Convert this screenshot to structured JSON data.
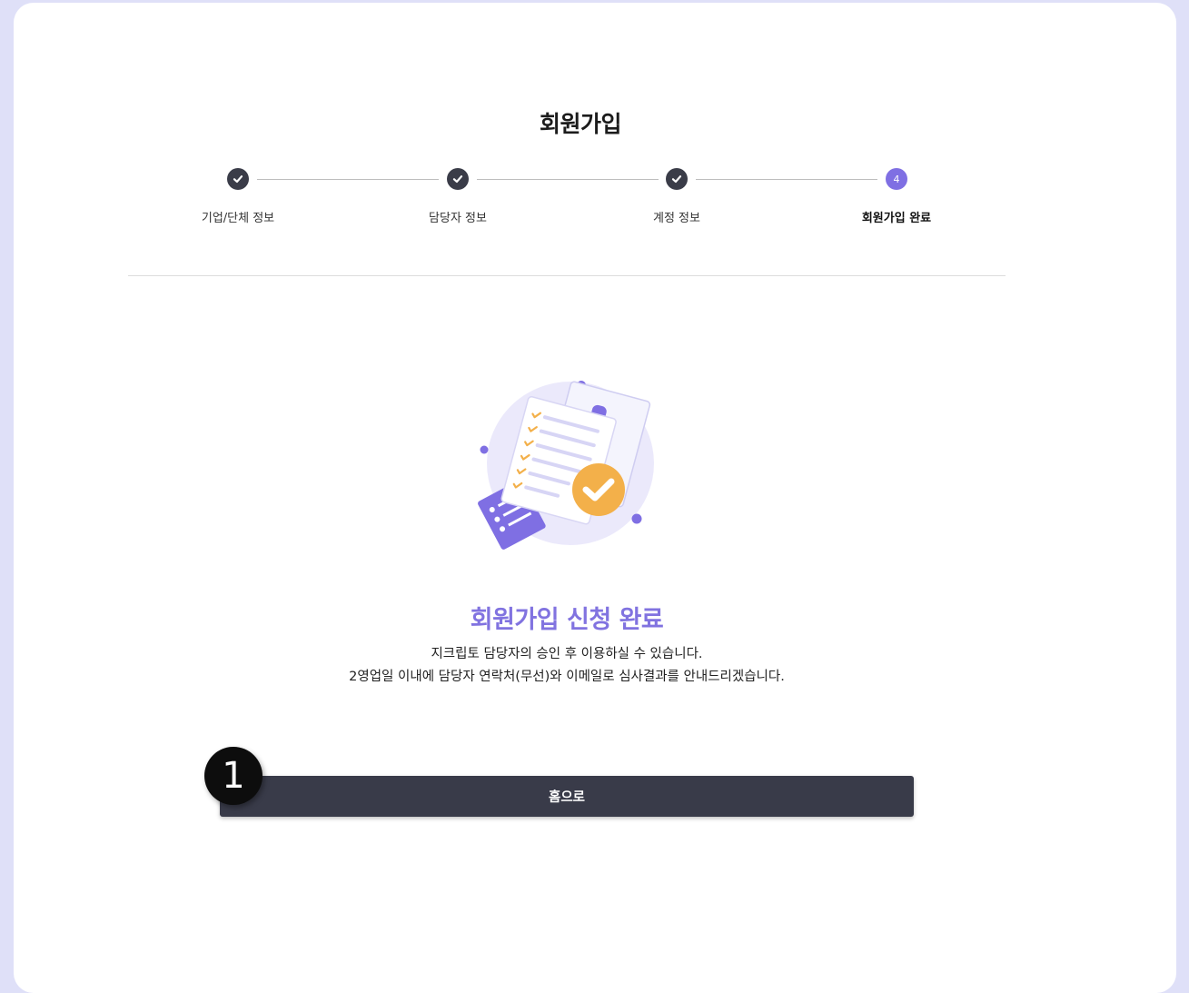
{
  "page": {
    "title": "회원가입"
  },
  "steps": [
    {
      "label": "기업/단체 정보",
      "state": "done"
    },
    {
      "label": "담당자 정보",
      "state": "done"
    },
    {
      "label": "계정 정보",
      "state": "done"
    },
    {
      "label": "회원가입 완료",
      "state": "current",
      "number": "4"
    }
  ],
  "completion": {
    "title": "회원가입 신청 완료",
    "description_line1": "지크립토 담당자의 승인 후 이용하실 수 있습니다.",
    "description_line2": "2영업일 이내에 담당자 연락처(무선)와 이메일로 심사결과를 안내드리겠습니다."
  },
  "home_button": {
    "label": "홈으로"
  },
  "annotation_marker": {
    "label": "1"
  },
  "colors": {
    "accent": "#7f6fe3",
    "step_done": "#3a3c48",
    "button_bg": "#393b49",
    "check_orange": "#f3b04a"
  }
}
